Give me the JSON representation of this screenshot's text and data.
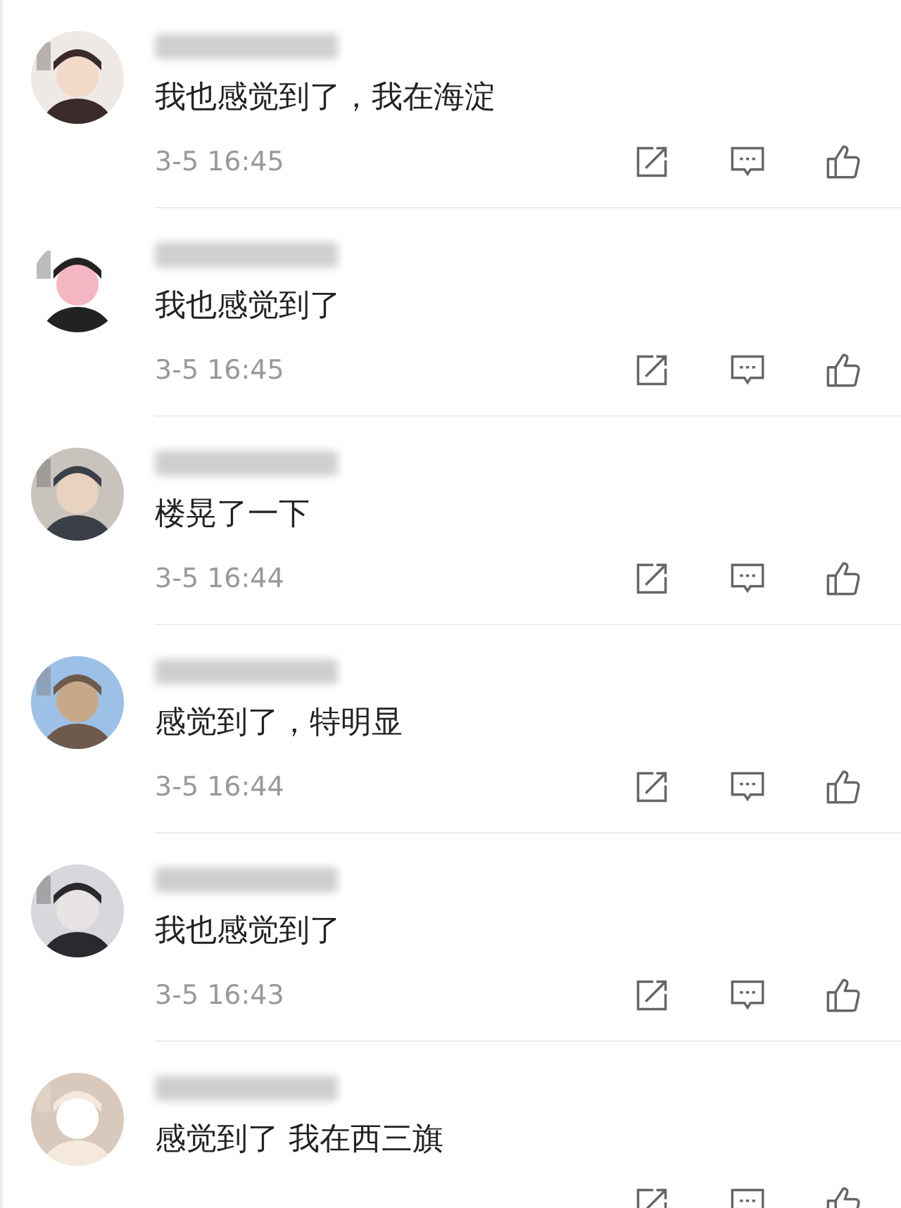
{
  "comments": [
    {
      "text": "我也感觉到了，我在海淀",
      "time": "3-5 16:45"
    },
    {
      "text": "我也感觉到了",
      "time": "3-5 16:45"
    },
    {
      "text": "楼晃了一下",
      "time": "3-5 16:44"
    },
    {
      "text": "感觉到了，特明显",
      "time": "3-5 16:44"
    },
    {
      "text": "我也感觉到了",
      "time": "3-5 16:43"
    },
    {
      "text": "感觉到了 我在西三旗"
    }
  ]
}
